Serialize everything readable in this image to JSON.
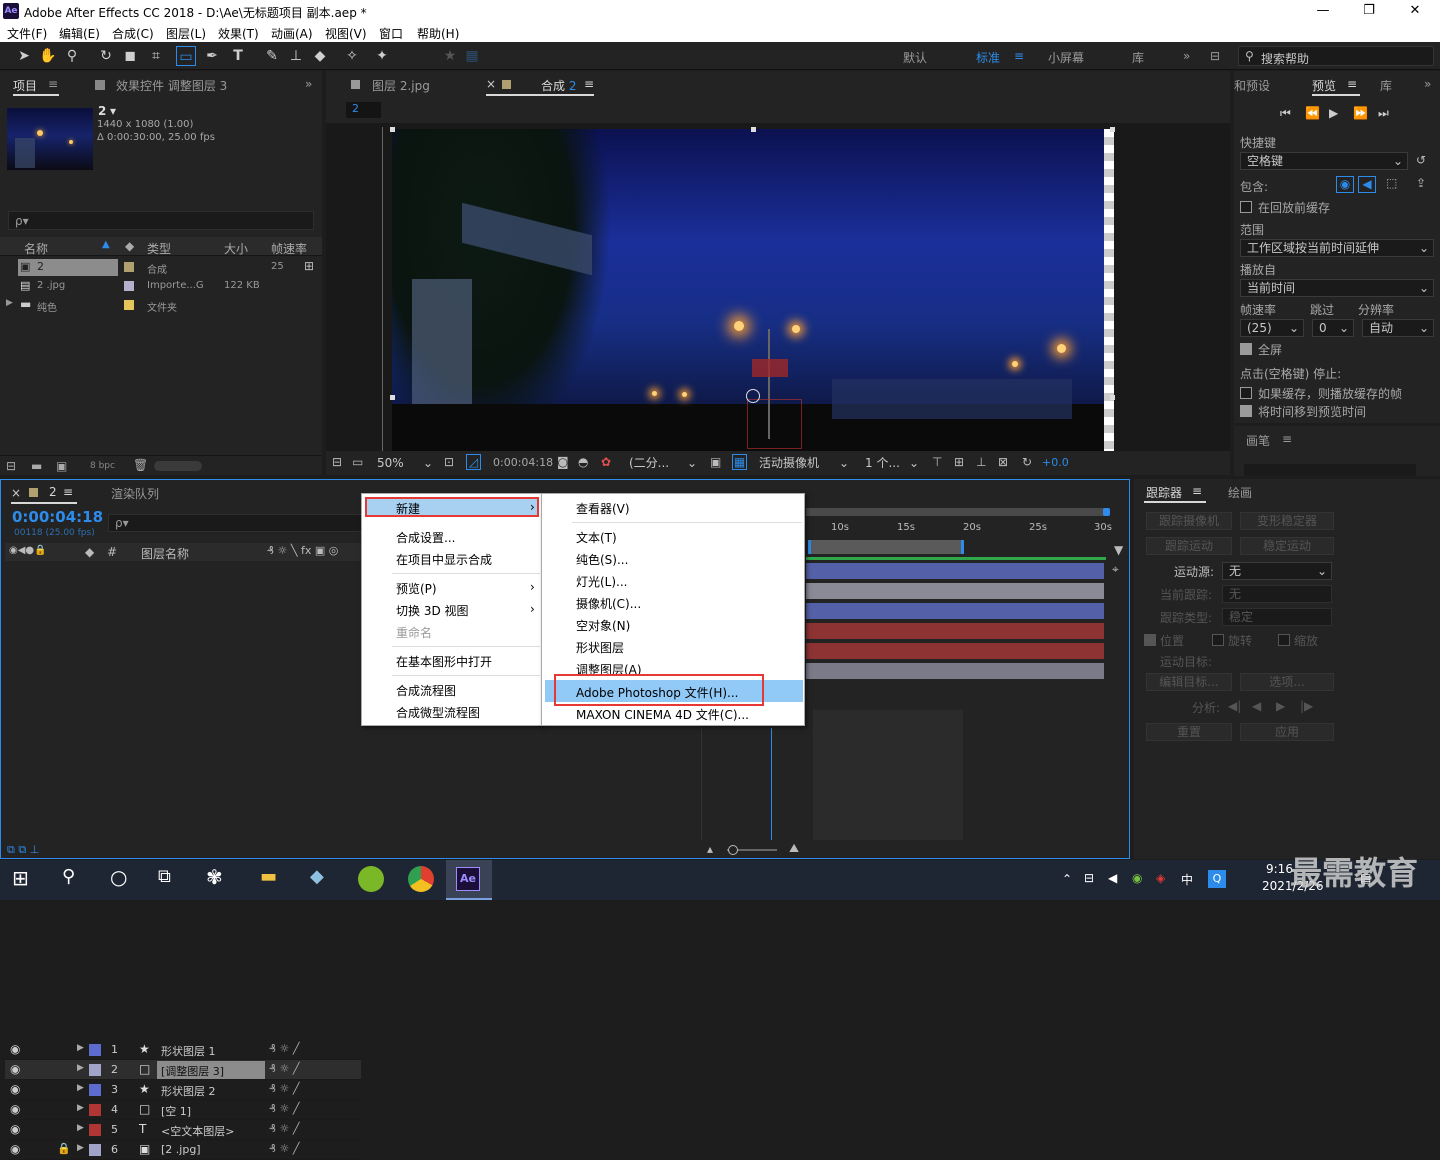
{
  "window": {
    "title": "Adobe After Effects CC 2018 - D:\\Ae\\无标题项目 副本.aep *",
    "minimize": "—",
    "maximize": "❐",
    "close": "✕",
    "logo": "Ae"
  },
  "menu": [
    "文件(F)",
    "编辑(E)",
    "合成(C)",
    "图层(L)",
    "效果(T)",
    "动画(A)",
    "视图(V)",
    "窗口",
    "帮助(H)"
  ],
  "workspaces": {
    "default": "默认",
    "standard": "标准",
    "small": "小屏幕",
    "library": "库",
    "more": "»"
  },
  "search_help": "搜索帮助",
  "project": {
    "tab": "项目",
    "effects_tab": "效果控件 调整图层 3",
    "comp_name": "2",
    "comp_info1": "1440 x 1080 (1.00)",
    "comp_info2": "Δ 0:00:30:00, 25.00 fps",
    "search_placeholder": "ρ▾",
    "columns": [
      "名称",
      "类型",
      "大小",
      "帧速率"
    ],
    "items": [
      {
        "name": "2",
        "type": "合成",
        "size": "",
        "fps": "25",
        "color": "#b0a070"
      },
      {
        "name": "2 .jpg",
        "type": "Importe...G",
        "size": "122 KB",
        "fps": "",
        "color": "#b5b0cc"
      },
      {
        "name": "纯色",
        "type": "文件夹",
        "size": "",
        "fps": "",
        "color": "#e6c65a"
      }
    ],
    "bpc": "8 bpc"
  },
  "viewer": {
    "tab_layer": "图层 2.jpg",
    "tab_comp": "合成 2",
    "comp_label": "2",
    "zoom": "50%",
    "timecode": "0:00:04:18",
    "resolution": "(二分...",
    "camera": "活动摄像机",
    "views": "1 个...",
    "exposure": "+0.0"
  },
  "preview": {
    "tab_presets": "和预设",
    "tab_preview": "预览",
    "tab_library": "库",
    "shortcut_label": "快捷键",
    "shortcut_value": "空格键",
    "include_label": "包含:",
    "cache_before": "在回放前缓存",
    "range_label": "范围",
    "range_value": "工作区域按当前时间延伸",
    "play_from_label": "播放自",
    "play_from_value": "当前时间",
    "fps_label": "帧速率",
    "skip_label": "跳过",
    "res_label": "分辨率",
    "fps_value": "(25)",
    "skip_value": "0",
    "res_value": "自动",
    "fullscreen": "全屏",
    "stop_hint": "点击(空格键) 停止:",
    "opt1": "如果缓存，则播放缓存的帧",
    "opt2": "将时间移到预览时间",
    "brush": "画笔"
  },
  "timeline": {
    "tab_comp": "2",
    "tab_render": "渲染队列",
    "timecode": "0:00:04:18",
    "frames": "00118 (25.00 fps)",
    "search_placeholder": "ρ▾",
    "col_name": "图层名称",
    "ticks": [
      "10s",
      "15s",
      "20s",
      "25s",
      "30s"
    ],
    "layers": [
      {
        "num": "1",
        "icon": "★",
        "name": "形状图层 1",
        "color": "#5d6ad0",
        "bar": "#5460a8"
      },
      {
        "num": "2",
        "icon": "□",
        "name": "[调整图层 3]",
        "color": "#a1a4c8",
        "bar": "#8a8a96"
      },
      {
        "num": "3",
        "icon": "★",
        "name": "形状图层 2",
        "color": "#5d6ad0",
        "bar": "#5460a8"
      },
      {
        "num": "4",
        "icon": "□",
        "name": "[空 1]",
        "color": "#b03535",
        "bar": "#8e3333"
      },
      {
        "num": "5",
        "icon": "T",
        "name": "<空文本图层>",
        "color": "#b03535",
        "bar": "#8e3333"
      },
      {
        "num": "6",
        "icon": "▣",
        "name": "[2 .jpg]",
        "color": "#a1a4c8",
        "bar": "#7a7a88"
      }
    ]
  },
  "context_menu": {
    "items": [
      "新建",
      "合成设置...",
      "在项目中显示合成",
      "预览(P)",
      "切换 3D 视图",
      "重命名",
      "在基本图形中打开",
      "合成流程图",
      "合成微型流程图"
    ]
  },
  "submenu": {
    "items": [
      "查看器(V)",
      "文本(T)",
      "纯色(S)...",
      "灯光(L)...",
      "摄像机(C)...",
      "空对象(N)",
      "形状图层",
      "调整图层(A)",
      "Adobe Photoshop 文件(H)...",
      "MAXON CINEMA 4D 文件(C)..."
    ]
  },
  "tracker": {
    "tab": "跟踪器",
    "tab2": "绘画",
    "track_camera": "跟踪摄像机",
    "warp_stabilize": "变形稳定器",
    "track_motion": "跟踪运动",
    "stabilize_motion": "稳定运动",
    "source_label": "运动源:",
    "source_value": "无",
    "current_label": "当前跟踪:",
    "current_value": "无",
    "type_label": "跟踪类型:",
    "type_value": "稳定",
    "pos": "位置",
    "rot": "旋转",
    "scale": "缩放",
    "target_label": "运动目标:",
    "edit_target": "编辑目标...",
    "options": "选项...",
    "analyze": "分析:",
    "reset": "重置",
    "apply": "应用"
  },
  "taskbar": {
    "time": "9:16",
    "date": "2021/2/26",
    "ime": "中",
    "watermark": "最需教育"
  }
}
